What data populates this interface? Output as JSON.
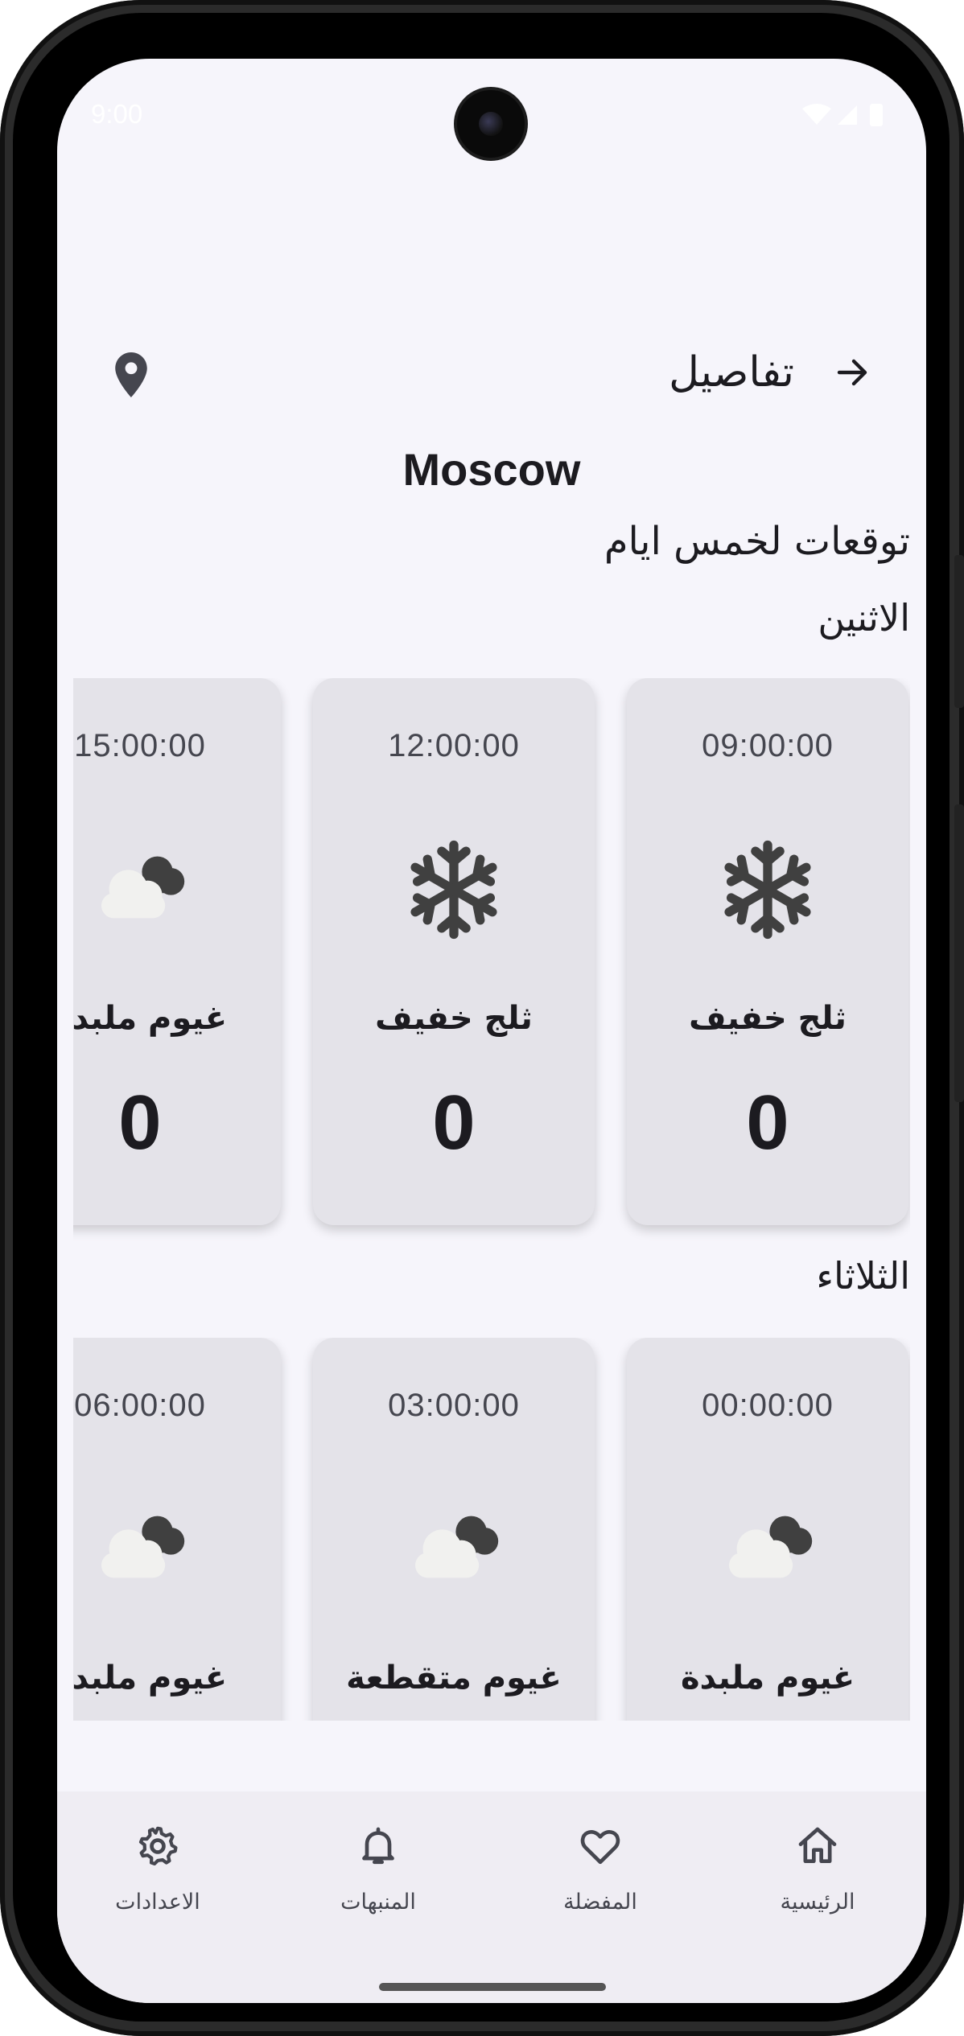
{
  "status_bar": {
    "time": "9:00"
  },
  "header": {
    "details_label": "تفاصيل"
  },
  "city": "Moscow",
  "forecast_title": "توقعات لخمس ايام",
  "days": [
    {
      "name": "الاثنين",
      "cards": [
        {
          "time": "09:00:00",
          "icon": "snowflake-icon",
          "desc": "ثلج خفيف",
          "temp": "0"
        },
        {
          "time": "12:00:00",
          "icon": "snowflake-icon",
          "desc": "ثلج خفيف",
          "temp": "0"
        },
        {
          "time": "15:00:00",
          "icon": "clouds-icon",
          "desc": "غيوم ملبدة",
          "temp": "0"
        }
      ]
    },
    {
      "name": "الثلاثاء",
      "cards": [
        {
          "time": "00:00:00",
          "icon": "clouds-icon",
          "desc": "غيوم ملبدة",
          "temp": ""
        },
        {
          "time": "03:00:00",
          "icon": "clouds-icon",
          "desc": "غيوم متقطعة",
          "temp": ""
        },
        {
          "time": "06:00:00",
          "icon": "clouds-icon",
          "desc": "غيوم ملبدة",
          "temp": ""
        }
      ]
    }
  ],
  "nav": {
    "home": "الرئيسية",
    "favorites": "المفضلة",
    "alerts": "المنبهات",
    "settings": "الاعدادات"
  },
  "colors": {
    "background": "#f6f5fb",
    "card": "#e4e3e9",
    "nav": "#efedf3",
    "text": "#1c1b20"
  }
}
